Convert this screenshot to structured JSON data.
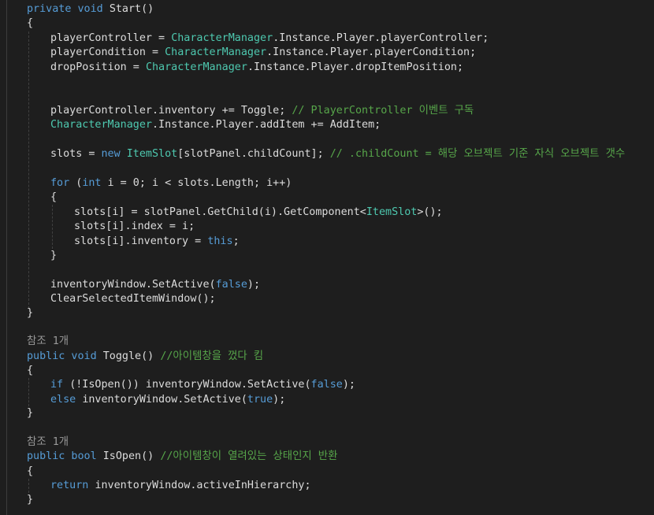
{
  "colors": {
    "background": "#1e1e1e",
    "keyword": "#569cd6",
    "type": "#4ec9b0",
    "comment": "#57a64a",
    "plain": "#dcdcdc",
    "codelens": "#999999"
  },
  "code": {
    "l1": {
      "kw": "private void ",
      "pl": "Start()"
    },
    "l2": {
      "pl": "{"
    },
    "l3": {
      "p1": "playerController = ",
      "t1": "CharacterManager",
      "p2": ".Instance.Player.playerController;"
    },
    "l4": {
      "p1": "playerCondition = ",
      "t1": "CharacterManager",
      "p2": ".Instance.Player.playerCondition;"
    },
    "l5": {
      "p1": "dropPosition = ",
      "t1": "CharacterManager",
      "p2": ".Instance.Player.dropItemPosition;"
    },
    "l6": {
      "p1": "playerController.inventory += Toggle; ",
      "c1": "// PlayerController 이벤트 구독"
    },
    "l7": {
      "t1": "CharacterManager",
      "p1": ".Instance.Player.addItem += AddItem;"
    },
    "l8": {
      "p1": "slots = ",
      "k1": "new ",
      "t1": "ItemSlot",
      "p2": "[slotPanel.childCount]; ",
      "c1": "// .childCount = 해당 오브젝트 기준 자식 오브젝트 갯수"
    },
    "l9": {
      "k1": "for ",
      "p1": "(",
      "k2": "int",
      "p2": " i = 0; i < slots.Length; i++)"
    },
    "l10": {
      "pl": "{"
    },
    "l11": {
      "p1": "slots[i] = slotPanel.GetChild(i).GetComponent<",
      "t1": "ItemSlot",
      "p2": ">();"
    },
    "l12": {
      "pl": "slots[i].index = i;"
    },
    "l13": {
      "p1": "slots[i].inventory = ",
      "k1": "this",
      "p2": ";"
    },
    "l14": {
      "pl": "}"
    },
    "l15": {
      "p1": "inventoryWindow.SetActive(",
      "k1": "false",
      "p2": ");"
    },
    "l16": {
      "pl": "ClearSelectedItemWindow();"
    },
    "l17": {
      "pl": "}"
    },
    "lens1": "참조 1개",
    "l18": {
      "kw": "public void ",
      "pl": "Toggle() ",
      "cm": "//아이템창을 껐다 킴"
    },
    "l19": {
      "pl": "{"
    },
    "l20": {
      "k1": "if ",
      "p1": "(!IsOpen()) inventoryWindow.SetActive(",
      "k2": "false",
      "p2": ");"
    },
    "l21": {
      "k1": "else ",
      "p1": "inventoryWindow.SetActive(",
      "k2": "true",
      "p2": ");"
    },
    "l22": {
      "pl": "}"
    },
    "lens2": "참조 1개",
    "l23": {
      "kw": "public bool ",
      "pl": "IsOpen() ",
      "cm": "//아이템창이 열려있는 상태인지 반환"
    },
    "l24": {
      "pl": "{"
    },
    "l25": {
      "k1": "return ",
      "p1": "inventoryWindow.activeInHierarchy;"
    },
    "l26": {
      "pl": "}"
    }
  }
}
